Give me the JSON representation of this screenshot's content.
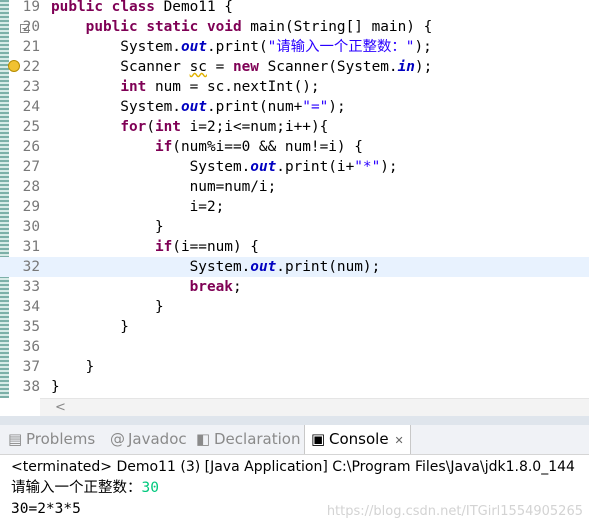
{
  "editor": {
    "lines": [
      {
        "n": "19",
        "tokens": [
          {
            "t": "public",
            "c": "kw"
          },
          {
            "t": " "
          },
          {
            "t": "class",
            "c": "kw"
          },
          {
            "t": " Demo11 {"
          }
        ]
      },
      {
        "n": "20",
        "tokens": [
          {
            "t": "    "
          },
          {
            "t": "public",
            "c": "kw"
          },
          {
            "t": " "
          },
          {
            "t": "static",
            "c": "kw"
          },
          {
            "t": " "
          },
          {
            "t": "void",
            "c": "kw"
          },
          {
            "t": " main(String[] main) {"
          }
        ]
      },
      {
        "n": "21",
        "tokens": [
          {
            "t": "        System."
          },
          {
            "t": "out",
            "c": "fld"
          },
          {
            "t": ".print("
          },
          {
            "t": "\"请输入一个正整数：\"",
            "c": "str"
          },
          {
            "t": ");"
          }
        ]
      },
      {
        "n": "22",
        "tokens": [
          {
            "t": "        Scanner "
          },
          {
            "t": "sc",
            "c": "squiggle"
          },
          {
            "t": " = "
          },
          {
            "t": "new",
            "c": "kw"
          },
          {
            "t": " Scanner(System."
          },
          {
            "t": "in",
            "c": "fld"
          },
          {
            "t": ");"
          }
        ]
      },
      {
        "n": "23",
        "tokens": [
          {
            "t": "        "
          },
          {
            "t": "int",
            "c": "kw"
          },
          {
            "t": " num = sc.nextInt();"
          }
        ]
      },
      {
        "n": "24",
        "tokens": [
          {
            "t": "        System."
          },
          {
            "t": "out",
            "c": "fld"
          },
          {
            "t": ".print(num+"
          },
          {
            "t": "\"=\"",
            "c": "str"
          },
          {
            "t": ");"
          }
        ]
      },
      {
        "n": "25",
        "tokens": [
          {
            "t": "        "
          },
          {
            "t": "for",
            "c": "kw"
          },
          {
            "t": "("
          },
          {
            "t": "int",
            "c": "kw"
          },
          {
            "t": " i=2;i<=num;i++){"
          }
        ]
      },
      {
        "n": "26",
        "tokens": [
          {
            "t": "            "
          },
          {
            "t": "if",
            "c": "kw"
          },
          {
            "t": "(num%i==0 && num!=i) {"
          }
        ]
      },
      {
        "n": "27",
        "tokens": [
          {
            "t": "                System."
          },
          {
            "t": "out",
            "c": "fld"
          },
          {
            "t": ".print(i+"
          },
          {
            "t": "\"*\"",
            "c": "str"
          },
          {
            "t": ");"
          }
        ]
      },
      {
        "n": "28",
        "tokens": [
          {
            "t": "                num=num/i;"
          }
        ]
      },
      {
        "n": "29",
        "tokens": [
          {
            "t": "                i=2;"
          }
        ]
      },
      {
        "n": "30",
        "tokens": [
          {
            "t": "            }"
          }
        ]
      },
      {
        "n": "31",
        "tokens": [
          {
            "t": "            "
          },
          {
            "t": "if",
            "c": "kw"
          },
          {
            "t": "(i==num) {"
          }
        ]
      },
      {
        "n": "32",
        "tokens": [
          {
            "t": "                System."
          },
          {
            "t": "out",
            "c": "fld"
          },
          {
            "t": ".print(num);"
          }
        ]
      },
      {
        "n": "33",
        "tokens": [
          {
            "t": "                "
          },
          {
            "t": "break",
            "c": "kw"
          },
          {
            "t": ";"
          }
        ]
      },
      {
        "n": "34",
        "tokens": [
          {
            "t": "            }"
          }
        ]
      },
      {
        "n": "35",
        "tokens": [
          {
            "t": "        }"
          }
        ]
      },
      {
        "n": "36",
        "tokens": []
      },
      {
        "n": "37",
        "tokens": [
          {
            "t": "    }"
          }
        ]
      },
      {
        "n": "38",
        "tokens": [
          {
            "t": "}"
          }
        ]
      }
    ],
    "highlighted_line": "32",
    "fold_marker_line": "20",
    "warning_line": "22",
    "scroll_left_icon": "chevron-left-icon"
  },
  "tabs": [
    {
      "label": "Problems",
      "icon": "problems-icon"
    },
    {
      "label": "Javadoc",
      "icon": "at-icon"
    },
    {
      "label": "Declaration",
      "icon": "declaration-icon"
    },
    {
      "label": "Console",
      "icon": "console-icon",
      "active": true,
      "close_icon": "close-icon"
    }
  ],
  "console": {
    "status": "<terminated> Demo11 (3) [Java Application] C:\\Program Files\\Java\\jdk1.8.0_144",
    "prompt": "请输入一个正整数：",
    "input": "30",
    "result": "30=2*3*5"
  },
  "watermark": "https://blog.csdn.net/ITGirl1554905265",
  "colors": {
    "keyword": "#7f0055",
    "string": "#2a00ff",
    "static_field": "#0000c0",
    "console_input": "#00c87d",
    "current_line": "#e8f2fe"
  }
}
